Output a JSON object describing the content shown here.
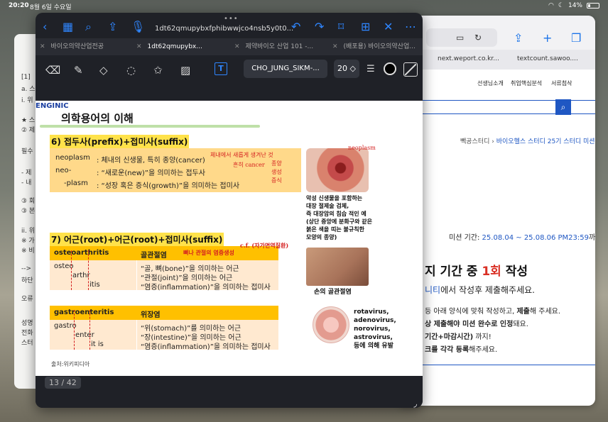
{
  "status": {
    "time": "20:20",
    "date": "8월 6일 수요일",
    "battery": "14%"
  },
  "left_window": {
    "lines": [
      "[1] ",
      "a. 스",
      "i. 위",
      "★ 스",
      "② 제",
      "필수",
      "- 제",
      "- 내",
      "③ 회",
      "③ 본",
      "ii. 위",
      "※ 가",
      "※ 비",
      "-->",
      "하단",
      "오류",
      "성명",
      "전화",
      "스터"
    ]
  },
  "right_browser": {
    "url_text_1": "",
    "tabs": [
      "next.weport.co.kr...",
      "textcount.sawoo...."
    ],
    "nav": [
      "선생님소개",
      "취업핵심분석",
      "서류첨삭"
    ],
    "breadcrumb": [
      "빽공스터디",
      "바이오헬스 스터디 25기 스터디 미션"
    ],
    "mission_label": "미션 기간:",
    "mission_dates": "25.08.04 ~ 25.08.06 PM23:59",
    "mission_suffix": "까지",
    "heading_pre": "지 기간 중 ",
    "heading_num": "1회",
    "heading_post": " 작성",
    "sub_blue": "니티",
    "sub_rest": "에서 작성후 제출해주세요.",
    "bullets": [
      {
        "pre": "등 아래 양식에 맞춰 작성하고, ",
        "bold": "제출",
        "post": "해 주세요."
      },
      {
        "pre": "",
        "bold": "상 제출해야 미션 완수로 인정",
        "post": "돼요."
      },
      {
        "pre": "",
        "bold": "기간+마감시간)",
        "post": " 까지!"
      },
      {
        "pre": "",
        "bold": "크를 각각 등록",
        "post": "해주세요."
      }
    ]
  },
  "main_app": {
    "doc_title": "1dt62qmupybxfphibwwjco4nsb5y0t0...",
    "tabs": [
      {
        "label": "바이오의약산업전공",
        "active": false
      },
      {
        "label": "1dt62qmupybx...",
        "active": true
      },
      {
        "label": "제약바이오 산업 101 -...",
        "active": false
      },
      {
        "label": "(배포용) 바이오의약산업...",
        "active": false
      }
    ],
    "toolbar": {
      "font_name": "CHO_JUNG_SIKM-...",
      "font_size": "20 ◇",
      "text_tool": "T"
    },
    "page_indicator": "13 / 42"
  },
  "pdf": {
    "brand": "ENGINIC",
    "title": "의학용어의 이해",
    "section6": {
      "title": "6) 접두사(prefix)+접미사(suffix)",
      "rows": [
        {
          "term": "neoplasm",
          "desc": ": 체내의 신생물, 특히 종양(cancer)"
        },
        {
          "term": "neo-",
          "desc": ": “새로운(new)”을 의미하는 접두사"
        },
        {
          "term": "-plasm",
          "desc": ": “성장 혹은 증식(growth)”을 의미하는 접미사"
        }
      ],
      "handwriting": [
        "neoplasm",
        "체내에서 새롭게 생겨난 것",
        "흔히 cancer",
        "종양",
        "생성",
        "증식"
      ],
      "image_caption": "악성 신생물을 포함하는\n대장 절제술 검체,\n즉 대장암의 침습 적인 예\n(상단 중앙에 분화구와 같은\n붉은 색을 띠는 불규칙한\n모양의 종양)"
    },
    "section7": {
      "title": "7) 어근(root)+어근(root)+접미사(suffix)",
      "table1": {
        "term": "osteoarthritis",
        "meaning": "골관절염",
        "parts": [
          "osteo",
          "arthr",
          "itis"
        ],
        "descs": [
          "“골, 뼈(bone)”을 의미하는 어근",
          "“관절(joint)”을 의미하는 어근",
          "“염증(inflammation)”을 의미하는 접미사"
        ],
        "handwriting": "뼈나 관절의 염증생성",
        "hw_cf": "c.f. (자가면역질환)",
        "caption": "손의 골관절염"
      },
      "table2": {
        "term": "gastroenteritis",
        "meaning": "위장염",
        "parts": [
          "gastro",
          "enter",
          "it is"
        ],
        "descs": [
          "“위(stomach)”를 의미하는 어근",
          "“장(intestine)”을 의미하는 어근",
          "“염증(inflammation)”을 의미하는 접미사"
        ],
        "caption": "rotavirus,\nadenovirus,\nnorovirus,\nastrovirus,\n등에 의해 유발"
      }
    },
    "source": "출처:위키피디아"
  }
}
